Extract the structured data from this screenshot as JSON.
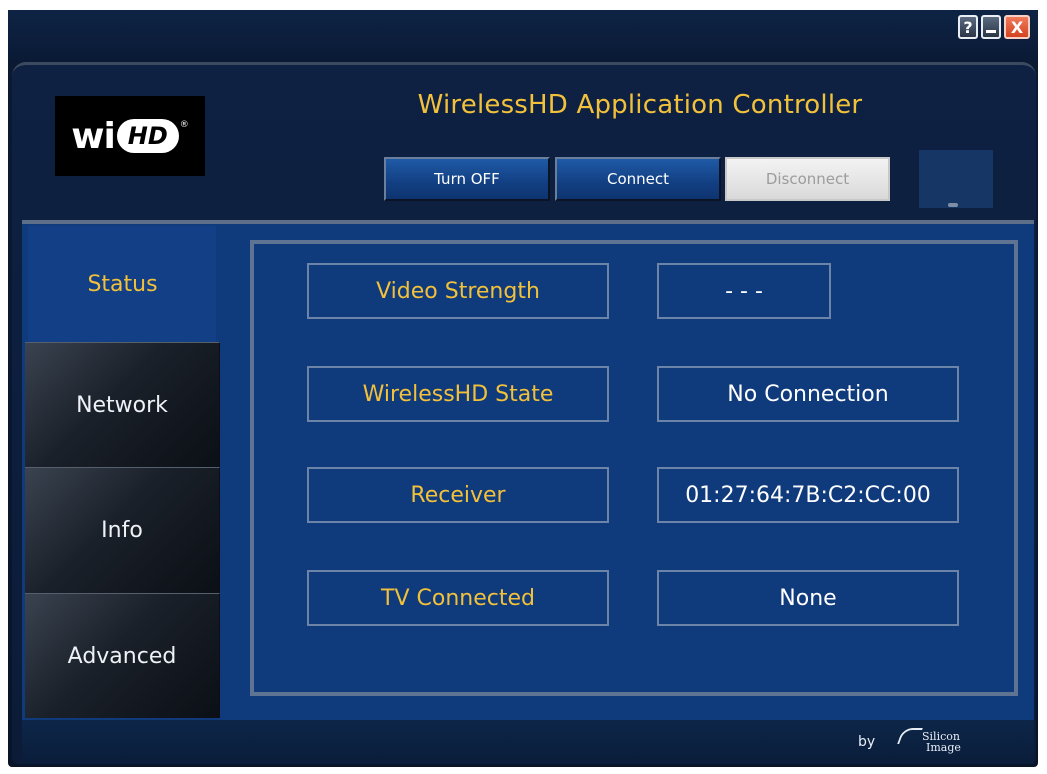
{
  "window": {
    "controls": {
      "help": "?",
      "minimize": "",
      "close": "X"
    }
  },
  "header": {
    "logo": {
      "text_wi": "wi",
      "text_hd": "HD",
      "mark": "®"
    },
    "title": "WirelessHD Application Controller",
    "buttons": {
      "turn_off": "Turn OFF",
      "connect": "Connect",
      "disconnect": "Disconnect"
    }
  },
  "tabs": [
    "Status",
    "Network",
    "Info",
    "Advanced"
  ],
  "status": {
    "rows": [
      {
        "label": "Video Strength",
        "value": "- - -"
      },
      {
        "label": "WirelessHD State",
        "value": "No Connection"
      },
      {
        "label": "Receiver",
        "value": "01:27:64:7B:C2:CC:00"
      },
      {
        "label": "TV Connected",
        "value": "None"
      }
    ]
  },
  "footer": {
    "by": "by",
    "brand_line1": "Silicon",
    "brand_line2": "Image"
  },
  "colors": {
    "accent_yellow": "#f2c13b",
    "panel_blue": "#0f3a7c",
    "frame_dark": "#0b1a33"
  },
  "icons": {
    "help": "question-icon",
    "minimize": "minimize-icon",
    "close": "close-icon",
    "signal": "signal-indicator-icon"
  }
}
